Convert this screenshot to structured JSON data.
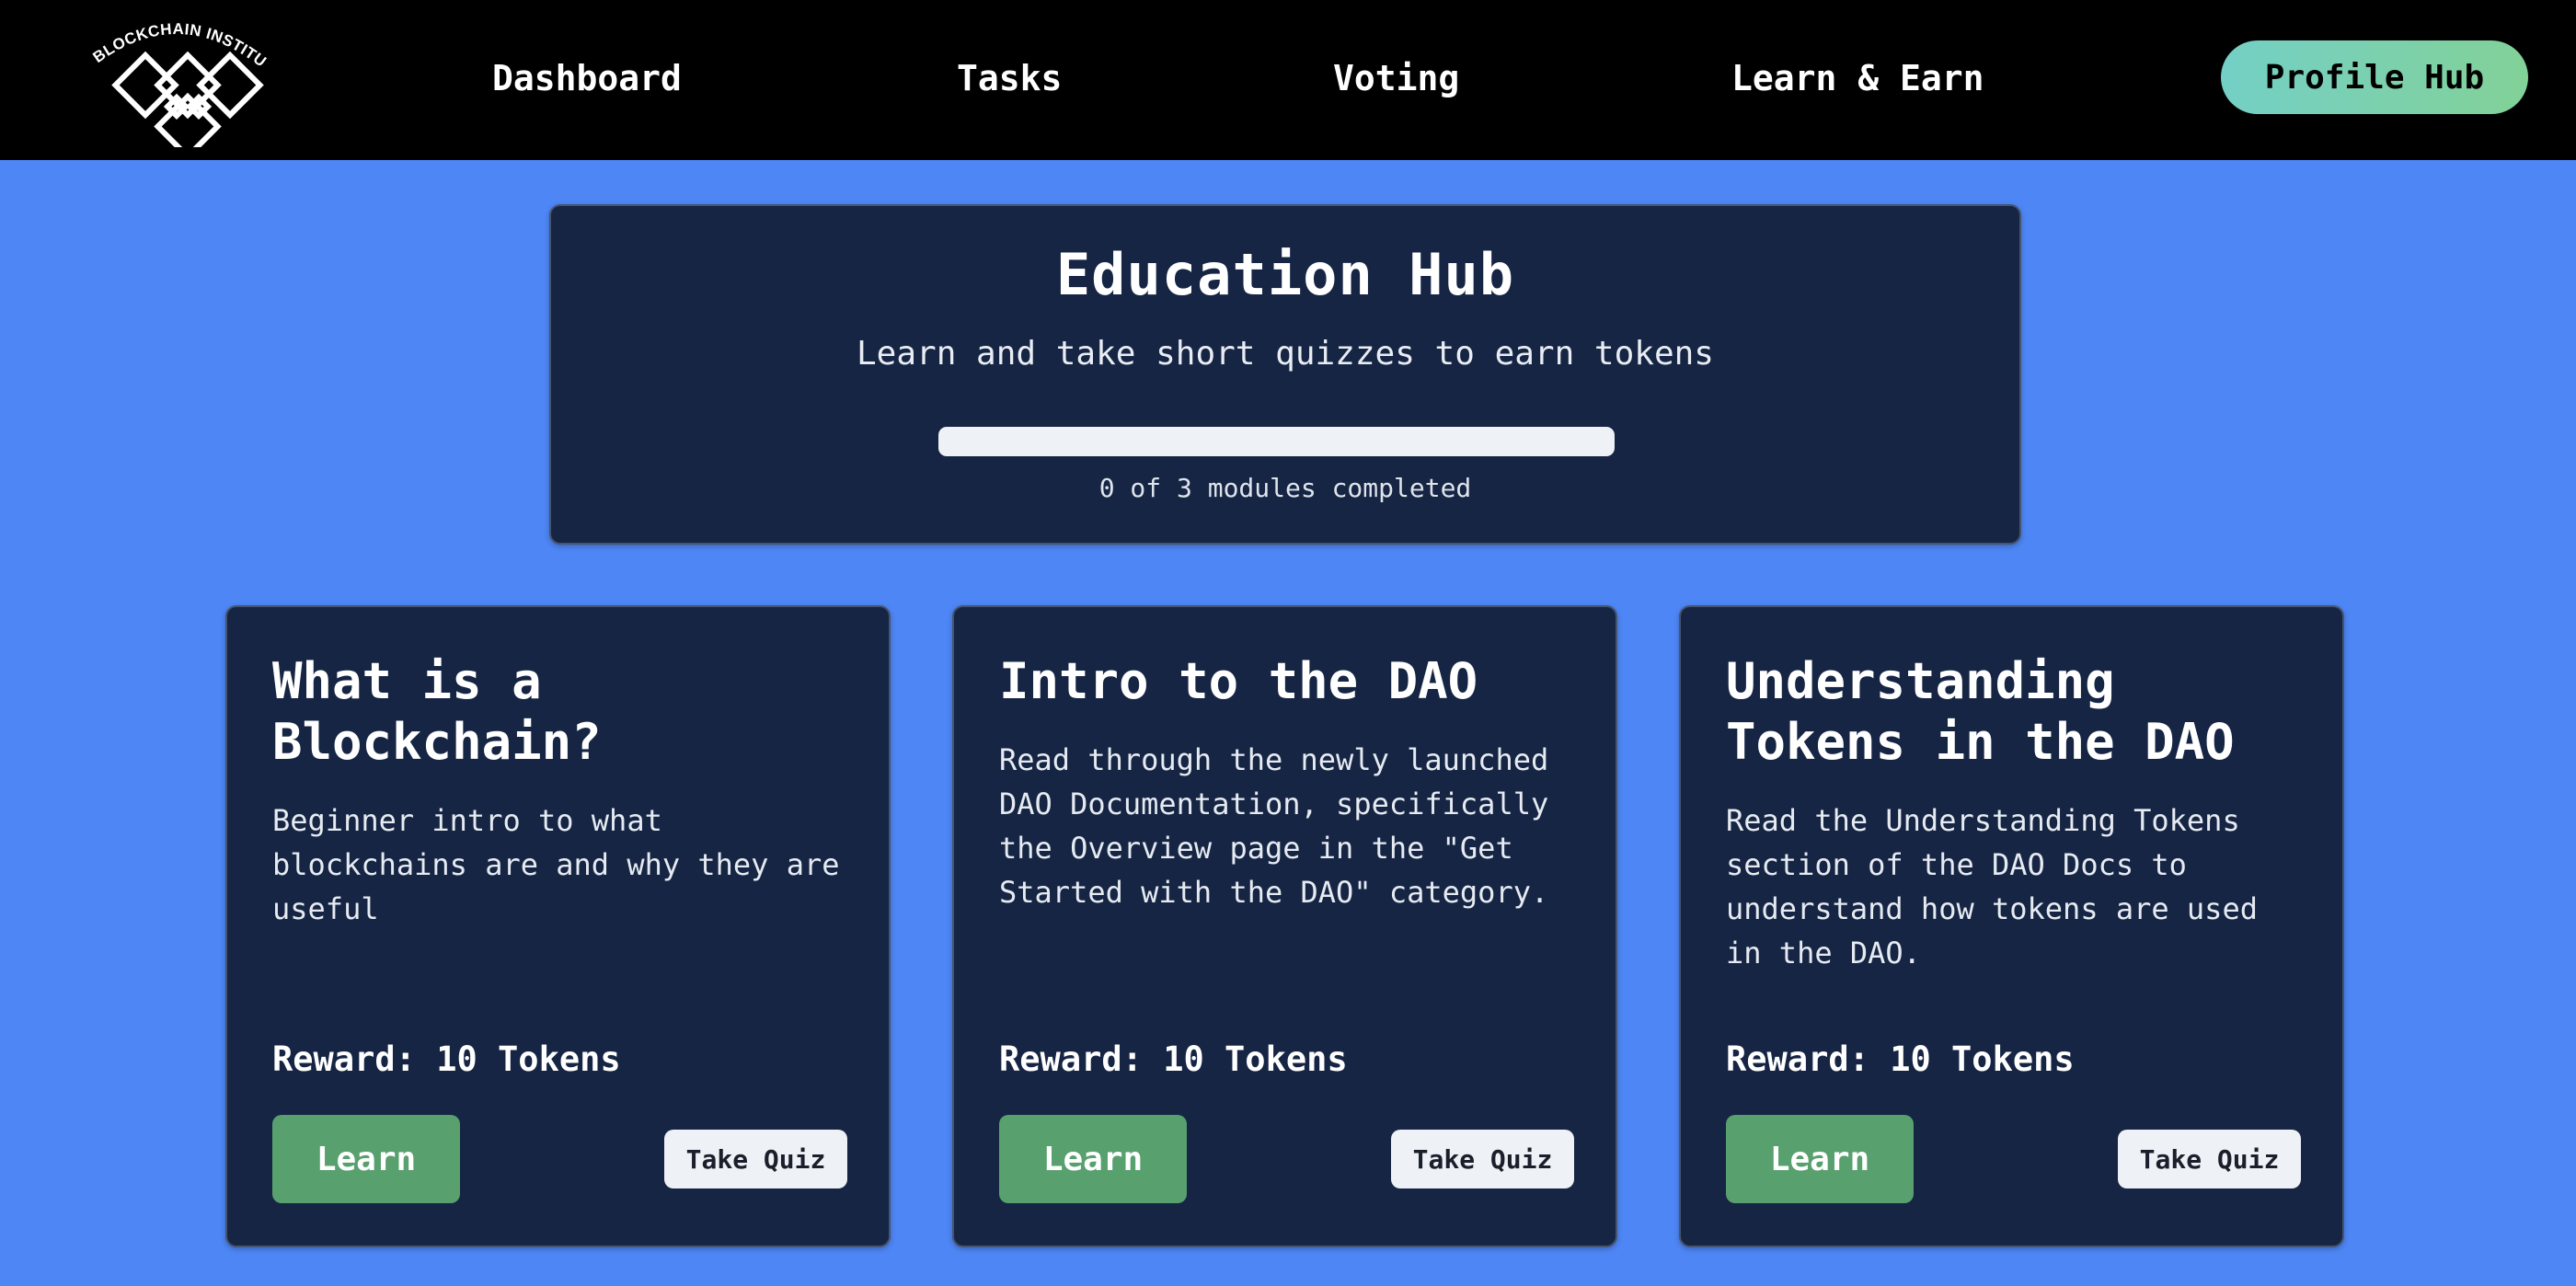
{
  "header": {
    "logo_text": "KU BLOCKCHAIN INSTITUTE",
    "nav": [
      {
        "label": "Dashboard"
      },
      {
        "label": "Tasks"
      },
      {
        "label": "Voting"
      },
      {
        "label": "Learn & Earn"
      }
    ],
    "profile_button": "Profile Hub"
  },
  "hero": {
    "title": "Education Hub",
    "subtitle": "Learn and take short quizzes to earn tokens",
    "progress": {
      "completed": 0,
      "total": 3,
      "label": "0 of 3 modules completed"
    }
  },
  "modules": [
    {
      "title": "What is a Blockchain?",
      "description": "Beginner intro to what blockchains are and why they are useful",
      "reward": "Reward: 10 Tokens",
      "learn_label": "Learn",
      "quiz_label": "Take Quiz"
    },
    {
      "title": "Intro to the DAO",
      "description": "Read through the newly launched DAO Documentation, specifically the Overview page in the \"Get Started with the DAO\" category.",
      "reward": "Reward: 10 Tokens",
      "learn_label": "Learn",
      "quiz_label": "Take Quiz"
    },
    {
      "title": "Understanding Tokens in the DAO",
      "description": "Read the Understanding Tokens section of the DAO Docs to understand how tokens are used in the DAO.",
      "reward": "Reward: 10 Tokens",
      "learn_label": "Learn",
      "quiz_label": "Take Quiz"
    }
  ],
  "colors": {
    "page_bg": "#4e86f5",
    "header_bg": "#000000",
    "card_bg": "#162544",
    "learn_button": "#58a06e",
    "quiz_button": "#eef1f5",
    "profile_gradient_start": "#74d0c6",
    "profile_gradient_end": "#82d197"
  }
}
